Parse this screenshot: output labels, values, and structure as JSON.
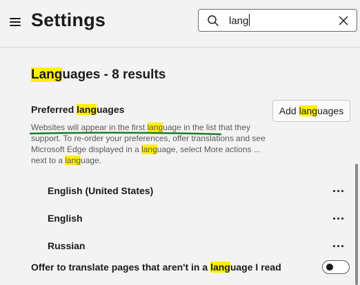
{
  "header": {
    "title": "Settings",
    "search_value": "lang",
    "menu_icon": "hamburger-menu-icon",
    "search_icon": "search-icon",
    "clear_icon": "close-icon"
  },
  "section": {
    "title_hl": "Lang",
    "title_rest": "uages - 8 results"
  },
  "preferred": {
    "label_pre": "Preferred ",
    "label_hl": "lang",
    "label_post": "uages",
    "add_pre": "Add ",
    "add_hl": "lang",
    "add_post": "uages",
    "desc_1": "Websites will appear in the first ",
    "desc_hl1": "lang",
    "desc_2": "uage in the list that they support. To re-order your preferences, offer translations and see Microsoft Edge displayed in a ",
    "desc_hl2": "lang",
    "desc_3": "uage, select More actions ... next to a ",
    "desc_hl3": "lang",
    "desc_4": "uage."
  },
  "languages": [
    {
      "name": "English (United States)"
    },
    {
      "name": "English"
    },
    {
      "name": "Russian"
    }
  ],
  "offer": {
    "pre": "Offer to translate pages that aren't in a ",
    "hl": "lang",
    "post": "uage I read",
    "toggle_on": false
  },
  "colors": {
    "highlight": "#fff000",
    "annotation_underline": "#1a7a2a"
  }
}
